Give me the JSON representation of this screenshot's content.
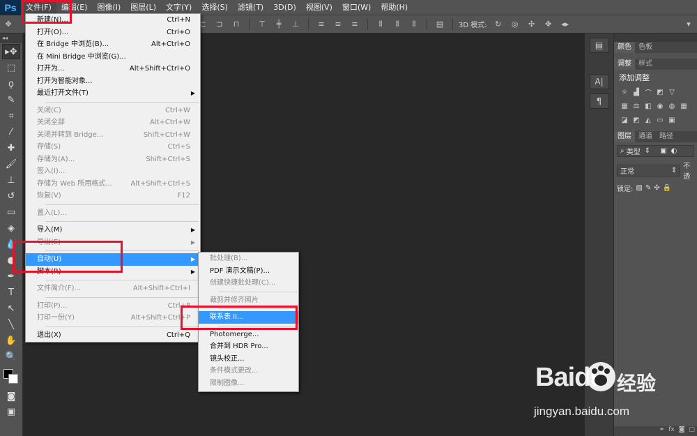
{
  "app": {
    "logo": "Ps"
  },
  "menubar": {
    "items": [
      {
        "label": "文件(F)",
        "active": true
      },
      {
        "label": "编辑(E)"
      },
      {
        "label": "图像(I)"
      },
      {
        "label": "图层(L)"
      },
      {
        "label": "文字(Y)"
      },
      {
        "label": "选择(S)"
      },
      {
        "label": "滤镜(T)"
      },
      {
        "label": "3D(D)"
      },
      {
        "label": "视图(V)"
      },
      {
        "label": "窗口(W)"
      },
      {
        "label": "帮助(H)"
      }
    ]
  },
  "optbar": {
    "mode3d_label": "3D 模式:"
  },
  "file_menu": {
    "items": [
      {
        "label": "新建(N)...",
        "shortcut": "Ctrl+N",
        "disabled": false
      },
      {
        "label": "打开(O)...",
        "shortcut": "Ctrl+O",
        "disabled": false
      },
      {
        "label": "在 Bridge 中浏览(B)...",
        "shortcut": "Alt+Ctrl+O",
        "disabled": false
      },
      {
        "label": "在 Mini Bridge 中浏览(G)...",
        "shortcut": "",
        "disabled": false
      },
      {
        "label": "打开为...",
        "shortcut": "Alt+Shift+Ctrl+O",
        "disabled": false
      },
      {
        "label": "打开为智能对象...",
        "shortcut": "",
        "disabled": false
      },
      {
        "label": "最近打开文件(T)",
        "shortcut": "",
        "disabled": false,
        "submenu": true
      },
      {
        "separator": true
      },
      {
        "label": "关闭(C)",
        "shortcut": "Ctrl+W",
        "disabled": true
      },
      {
        "label": "关闭全部",
        "shortcut": "Alt+Ctrl+W",
        "disabled": true
      },
      {
        "label": "关闭并转到 Bridge...",
        "shortcut": "Shift+Ctrl+W",
        "disabled": true
      },
      {
        "label": "存储(S)",
        "shortcut": "Ctrl+S",
        "disabled": true
      },
      {
        "label": "存储为(A)...",
        "shortcut": "Shift+Ctrl+S",
        "disabled": true
      },
      {
        "label": "签入(I)...",
        "shortcut": "",
        "disabled": true
      },
      {
        "label": "存储为 Web 所用格式...",
        "shortcut": "Alt+Shift+Ctrl+S",
        "disabled": true
      },
      {
        "label": "恢复(V)",
        "shortcut": "F12",
        "disabled": true
      },
      {
        "separator": true
      },
      {
        "label": "置入(L)...",
        "shortcut": "",
        "disabled": true
      },
      {
        "separator": true
      },
      {
        "label": "导入(M)",
        "shortcut": "",
        "disabled": false,
        "submenu": true
      },
      {
        "label": "导出(E)",
        "shortcut": "",
        "disabled": true,
        "submenu": true
      },
      {
        "separator": true
      },
      {
        "label": "自动(U)",
        "shortcut": "",
        "disabled": false,
        "submenu": true,
        "highlighted": true
      },
      {
        "label": "脚本(R)",
        "shortcut": "",
        "disabled": false,
        "submenu": true
      },
      {
        "separator": true
      },
      {
        "label": "文件简介(F)...",
        "shortcut": "Alt+Shift+Ctrl+I",
        "disabled": true
      },
      {
        "separator": true
      },
      {
        "label": "打印(P)...",
        "shortcut": "Ctrl+P",
        "disabled": true
      },
      {
        "label": "打印一份(Y)",
        "shortcut": "Alt+Shift+Ctrl+P",
        "disabled": true
      },
      {
        "separator": true
      },
      {
        "label": "退出(X)",
        "shortcut": "Ctrl+Q",
        "disabled": false
      }
    ]
  },
  "automate_menu": {
    "items": [
      {
        "label": "批处理(B)...",
        "disabled": true
      },
      {
        "label": "PDF 演示文稿(P)...",
        "disabled": false
      },
      {
        "label": "创建快捷批处理(C)...",
        "disabled": true
      },
      {
        "separator": true
      },
      {
        "label": "裁剪并修齐照片",
        "disabled": true
      },
      {
        "separator": true
      },
      {
        "label": "联系表 II...",
        "disabled": false,
        "highlighted": true
      },
      {
        "separator": true
      },
      {
        "label": "Photomerge...",
        "disabled": false
      },
      {
        "label": "合并到 HDR Pro...",
        "disabled": false
      },
      {
        "label": "镜头校正...",
        "disabled": false
      },
      {
        "label": "条件模式更改...",
        "disabled": true
      },
      {
        "label": "限制图像...",
        "disabled": true
      }
    ]
  },
  "panels": {
    "color_tabs": [
      "颜色",
      "色板"
    ],
    "adjust_tabs": [
      "调整",
      "样式"
    ],
    "adjust_title": "添加调整",
    "layers_tabs": [
      "图层",
      "通道",
      "路径"
    ],
    "filter_kind": "类型",
    "blend_mode": "正常",
    "opacity_label": "不透",
    "lock_label": "锁定:"
  },
  "watermark": {
    "brand": "Baidu",
    "cn": "经验",
    "url": "jingyan.baidu.com"
  },
  "colors": {
    "highlight": "#3399ff",
    "annotation_red": "#e8102a",
    "canvas_bg": "#282828",
    "panel_bg": "#535353"
  }
}
